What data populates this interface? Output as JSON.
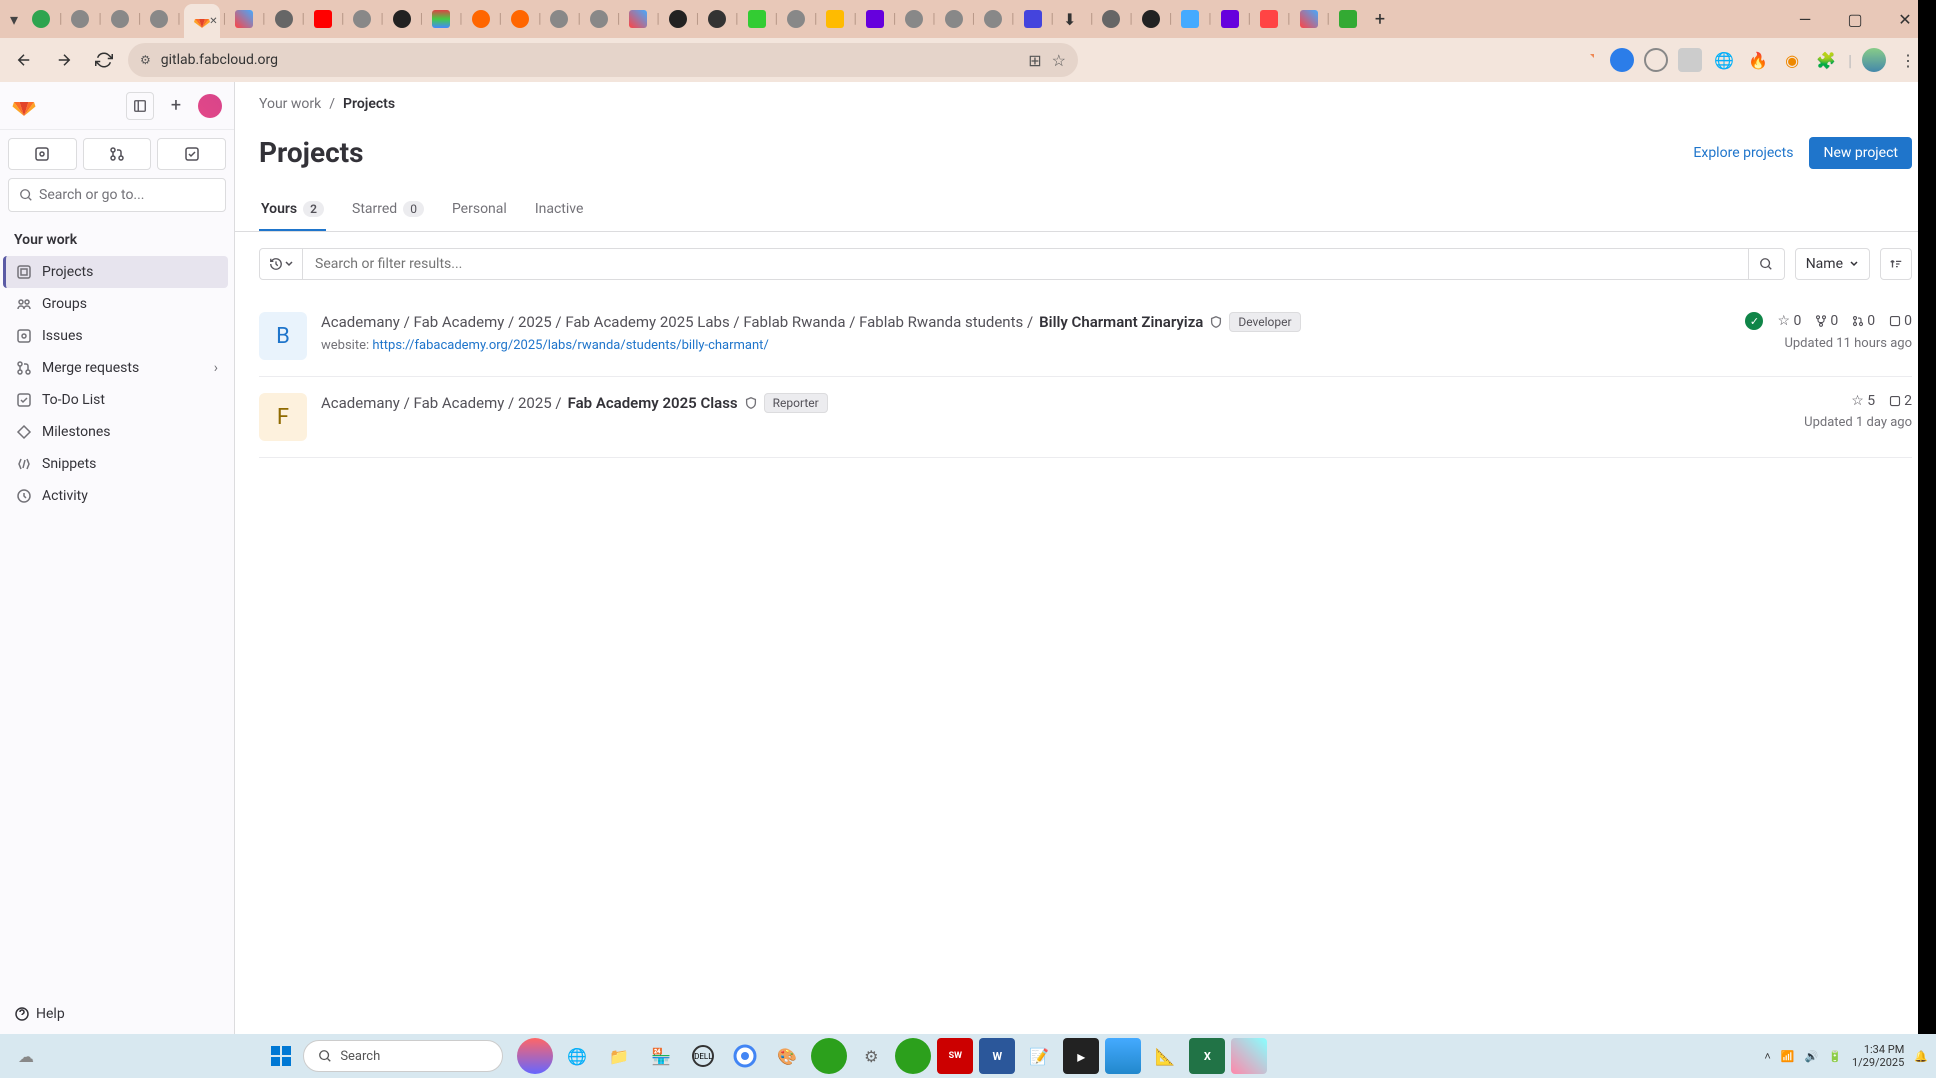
{
  "browser": {
    "url": "gitlab.fabcloud.org",
    "window_controls": {
      "min": "–",
      "max": "▢",
      "close": "✕"
    }
  },
  "sidebar": {
    "search_placeholder": "Search or go to...",
    "section_title": "Your work",
    "items": [
      {
        "icon": "project",
        "label": "Projects",
        "active": true
      },
      {
        "icon": "group",
        "label": "Groups"
      },
      {
        "icon": "issues",
        "label": "Issues"
      },
      {
        "icon": "merge",
        "label": "Merge requests",
        "chevron": true
      },
      {
        "icon": "todo",
        "label": "To-Do List"
      },
      {
        "icon": "milestone",
        "label": "Milestones"
      },
      {
        "icon": "snippet",
        "label": "Snippets"
      },
      {
        "icon": "activity",
        "label": "Activity"
      }
    ],
    "help_label": "Help"
  },
  "breadcrumb": {
    "root": "Your work",
    "current": "Projects"
  },
  "page": {
    "title": "Projects",
    "explore_link": "Explore projects",
    "new_button": "New project"
  },
  "tabs": [
    {
      "label": "Yours",
      "count": "2",
      "active": true
    },
    {
      "label": "Starred",
      "count": "0"
    },
    {
      "label": "Personal"
    },
    {
      "label": "Inactive"
    }
  ],
  "filter": {
    "placeholder": "Search or filter results...",
    "sort_label": "Name"
  },
  "projects": [
    {
      "avatar_letter": "B",
      "avatar_bg": "#e9f3fc",
      "avatar_color": "#1f75cb",
      "path_prefix": "Academany / Fab Academy / 2025 / Fab Academy 2025 Labs / Fablab Rwanda / Fablab Rwanda students / ",
      "name": "Billy Charmant Zinaryiza",
      "role": "Developer",
      "desc_label": "website: ",
      "desc_link": "https://fabacademy.org/2025/labs/rwanda/students/billy-charmant/",
      "pipeline": true,
      "stars": "0",
      "forks": "0",
      "mrs": "0",
      "issues": "0",
      "updated": "Updated 11 hours ago"
    },
    {
      "avatar_letter": "F",
      "avatar_bg": "#fdf1dd",
      "avatar_color": "#8f6a00",
      "path_prefix": "Academany / Fab Academy / 2025 / ",
      "name": "Fab Academy 2025 Class",
      "role": "Reporter",
      "stars": "5",
      "issues": "2",
      "updated": "Updated 1 day ago"
    }
  ],
  "taskbar": {
    "search_placeholder": "Search",
    "time": "1:34 PM",
    "date": "1/29/2025"
  }
}
